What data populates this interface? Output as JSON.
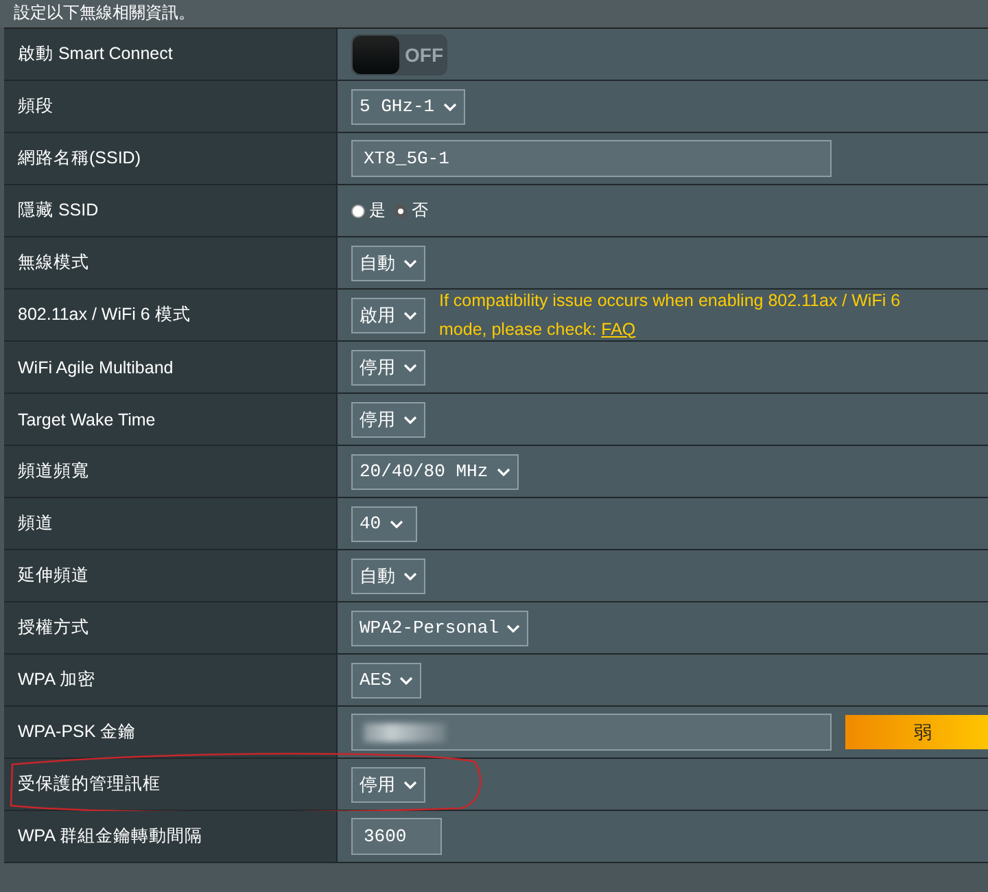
{
  "intro": "設定以下無線相關資訊。",
  "rows": [
    {
      "kind": "toggle",
      "label": "啟動 Smart Connect",
      "on": false,
      "value": "OFF",
      "annotated": false
    },
    {
      "kind": "select",
      "label": "頻段",
      "value": "5 GHz-1",
      "annotated": false
    },
    {
      "kind": "text",
      "label": "網路名稱(SSID)",
      "value": "XT8_5G-1",
      "annotated": false
    },
    {
      "kind": "radio",
      "label": "隱藏 SSID",
      "options": [
        {
          "label": "是",
          "selected": false
        },
        {
          "label": "否",
          "selected": true
        }
      ],
      "annotated": false
    },
    {
      "kind": "select",
      "label": "無線模式",
      "value": "自動",
      "annotated": false
    },
    {
      "kind": "select",
      "label": "802.11ax / WiFi 6 模式",
      "value": "啟用",
      "note": "If compatibility issue occurs when enabling 802.11ax / WiFi 6 mode, please check:",
      "link": "FAQ",
      "annotated": false
    },
    {
      "kind": "select",
      "label": "WiFi Agile Multiband",
      "value": "停用",
      "annotated": false
    },
    {
      "kind": "select",
      "label": "Target Wake Time",
      "value": "停用",
      "annotated": false
    },
    {
      "kind": "select",
      "label": "頻道頻寬",
      "value": "20/40/80 MHz",
      "annotated": false
    },
    {
      "kind": "select",
      "label": "頻道",
      "value": "40",
      "annotated": false
    },
    {
      "kind": "select",
      "label": "延伸頻道",
      "value": "自動",
      "annotated": false
    },
    {
      "kind": "select",
      "label": "授權方式",
      "value": "WPA2-Personal",
      "annotated": false
    },
    {
      "kind": "select",
      "label": "WPA 加密",
      "value": "AES",
      "annotated": false
    },
    {
      "kind": "password",
      "label": "WPA-PSK 金鑰",
      "strength": "弱",
      "annotated": false
    },
    {
      "kind": "select",
      "label": "受保護的管理訊框",
      "value": "停用",
      "annotated": true
    },
    {
      "kind": "number",
      "label": "WPA 群組金鑰轉動間隔",
      "value": "3600",
      "annotated": false
    }
  ]
}
